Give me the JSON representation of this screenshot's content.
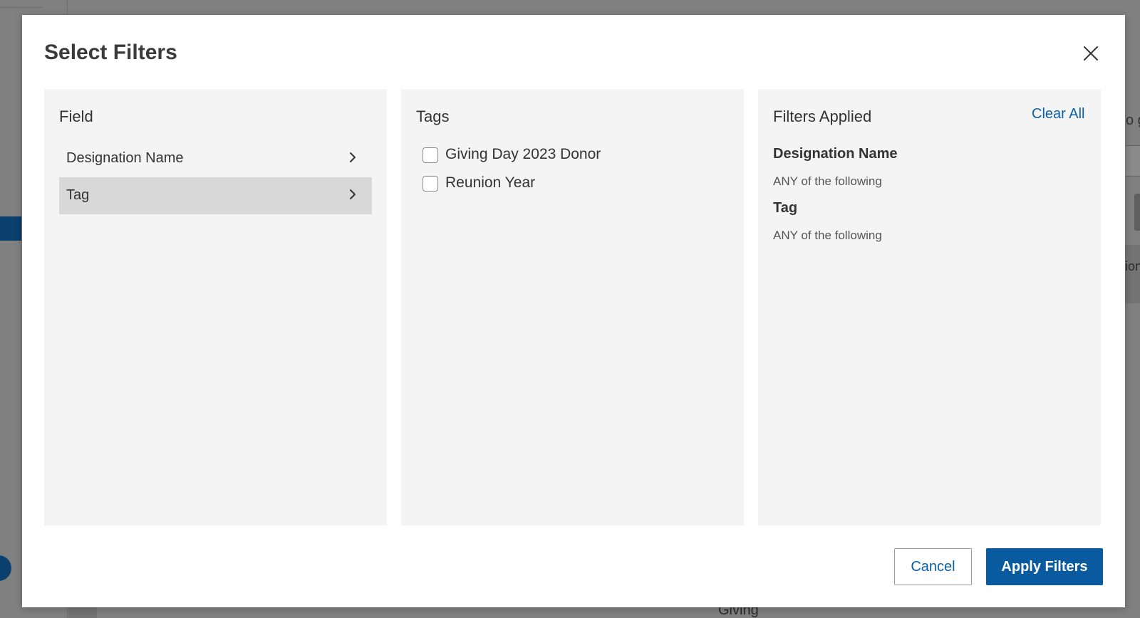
{
  "modal": {
    "title": "Select Filters"
  },
  "field_panel": {
    "heading": "Field",
    "items": [
      {
        "label": "Designation Name",
        "selected": false
      },
      {
        "label": "Tag",
        "selected": true
      }
    ]
  },
  "tags_panel": {
    "heading": "Tags",
    "options": [
      {
        "label": "Giving Day 2023 Donor",
        "checked": false
      },
      {
        "label": "Reunion Year",
        "checked": false
      }
    ]
  },
  "applied_panel": {
    "heading": "Filters Applied",
    "clear_all_label": "Clear All",
    "filters": [
      {
        "name": "Designation Name",
        "condition": "ANY of the following"
      },
      {
        "name": "Tag",
        "condition": "ANY of the following"
      }
    ]
  },
  "footer": {
    "cancel_label": "Cancel",
    "apply_label": "Apply Filters"
  },
  "background": {
    "partial_right_text": "o g",
    "partial_right_row_text": "ion",
    "partial_bottom_text": "Giving"
  },
  "colors": {
    "primary": "#0a5aa0",
    "link": "#0b5fa8",
    "panel_bg": "#f4f4f4",
    "selected_row": "#d8d8d8",
    "overlay": "#808080"
  }
}
